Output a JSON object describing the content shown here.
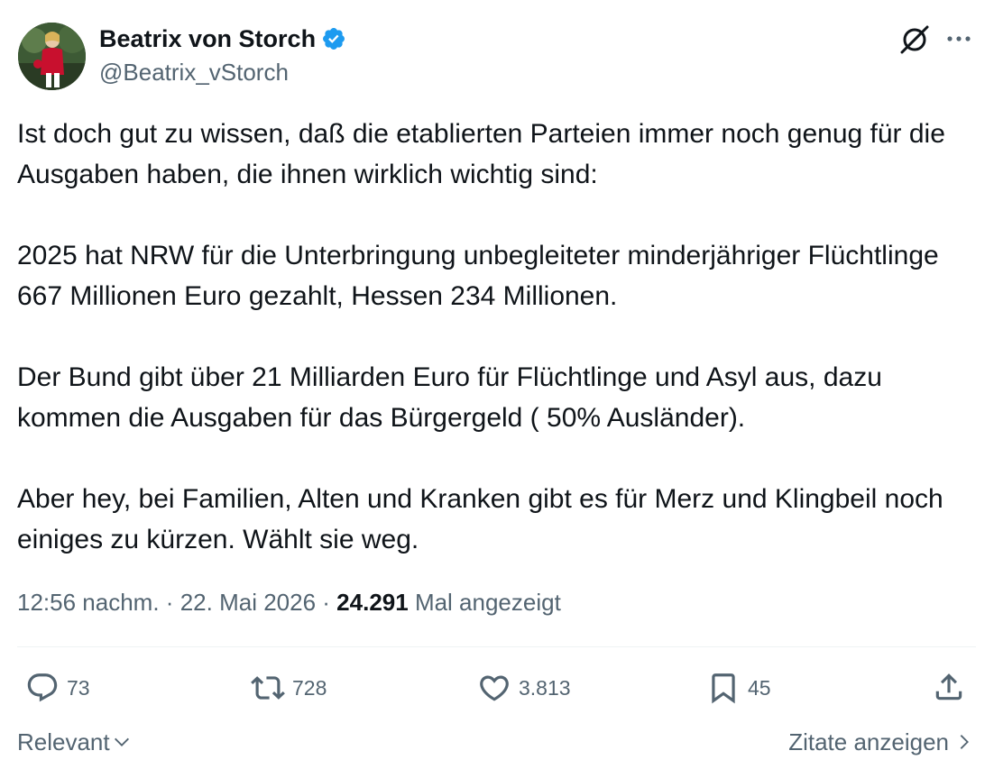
{
  "author": {
    "display_name": "Beatrix von Storch",
    "handle": "@Beatrix_vStorch",
    "verified_icon": "verified-badge-icon",
    "verified_color": "#1d9bf0"
  },
  "header_actions": {
    "grok_icon": "grok-icon",
    "more_icon": "more-options-icon"
  },
  "tweet": {
    "paragraphs": [
      "Ist doch gut zu wissen, daß die etablierten Parteien immer noch genug für die Ausgaben haben, die ihnen wirklich wichtig sind:",
      "2025 hat NRW für die Unterbringung unbegleiteter minderjähriger Flüchtlinge 667 Millionen Euro gezahlt, Hessen 234 Millionen.",
      "Der Bund gibt über 21 Milliarden Euro für Flüchtlinge und Asyl aus, dazu kommen die Ausgaben für das Bürgergeld ( 50% Ausländer).",
      "Aber hey, bei Familien, Alten und Kranken gibt es für Merz und Klingbeil noch einiges zu kürzen. Wählt sie weg."
    ],
    "time": "12:56 nachm.",
    "date": "22. Mai 2026",
    "separator": "·",
    "views_count": "24.291",
    "views_label": "Mal angezeigt"
  },
  "actions": {
    "reply_count": "73",
    "retweet_count": "728",
    "like_count": "3.813",
    "bookmark_count": "45",
    "icons": [
      "reply-icon",
      "retweet-icon",
      "like-icon",
      "bookmark-icon",
      "share-icon"
    ]
  },
  "footer": {
    "sort_label": "Relevant",
    "quotes_label": "Zitate anzeigen"
  },
  "colors": {
    "text_primary": "#0f1419",
    "text_secondary": "#536471",
    "divider": "#eff3f4"
  }
}
